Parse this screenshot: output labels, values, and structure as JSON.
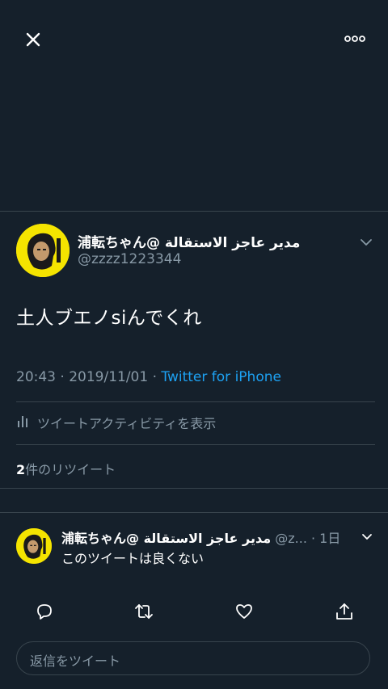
{
  "colors": {
    "background": "#15202b",
    "text_primary": "#ffffff",
    "text_secondary": "#8899a6",
    "link": "#1da1f2",
    "divider": "#38444d",
    "avatar_bg": "#f5e400"
  },
  "topbar": {
    "close_icon": "close-icon",
    "more_icon": "more-horizontal-icon"
  },
  "tweet": {
    "author_name": "浦転ちゃん@ مدير عاجز الاستقالة",
    "author_handle": "@zzzz1223344",
    "text": "土人ブエノsiんでくれ",
    "time": "20:43 · 2019/11/01 · ",
    "source": "Twitter for iPhone",
    "activity_label": "ツイートアクティビティを表示",
    "retweet_count": "2",
    "retweet_label": "件のリツイート"
  },
  "reply": {
    "author_name": "浦転ちゃん@ مدير عاجز الاستقالة",
    "author_handle": "@z...",
    "age": "· 1日",
    "text": "このツイートは良くない"
  },
  "actions": {
    "reply_icon": "reply-icon",
    "retweet_icon": "retweet-icon",
    "like_icon": "heart-icon",
    "share_icon": "share-icon"
  },
  "compose": {
    "placeholder": "返信をツイート"
  }
}
